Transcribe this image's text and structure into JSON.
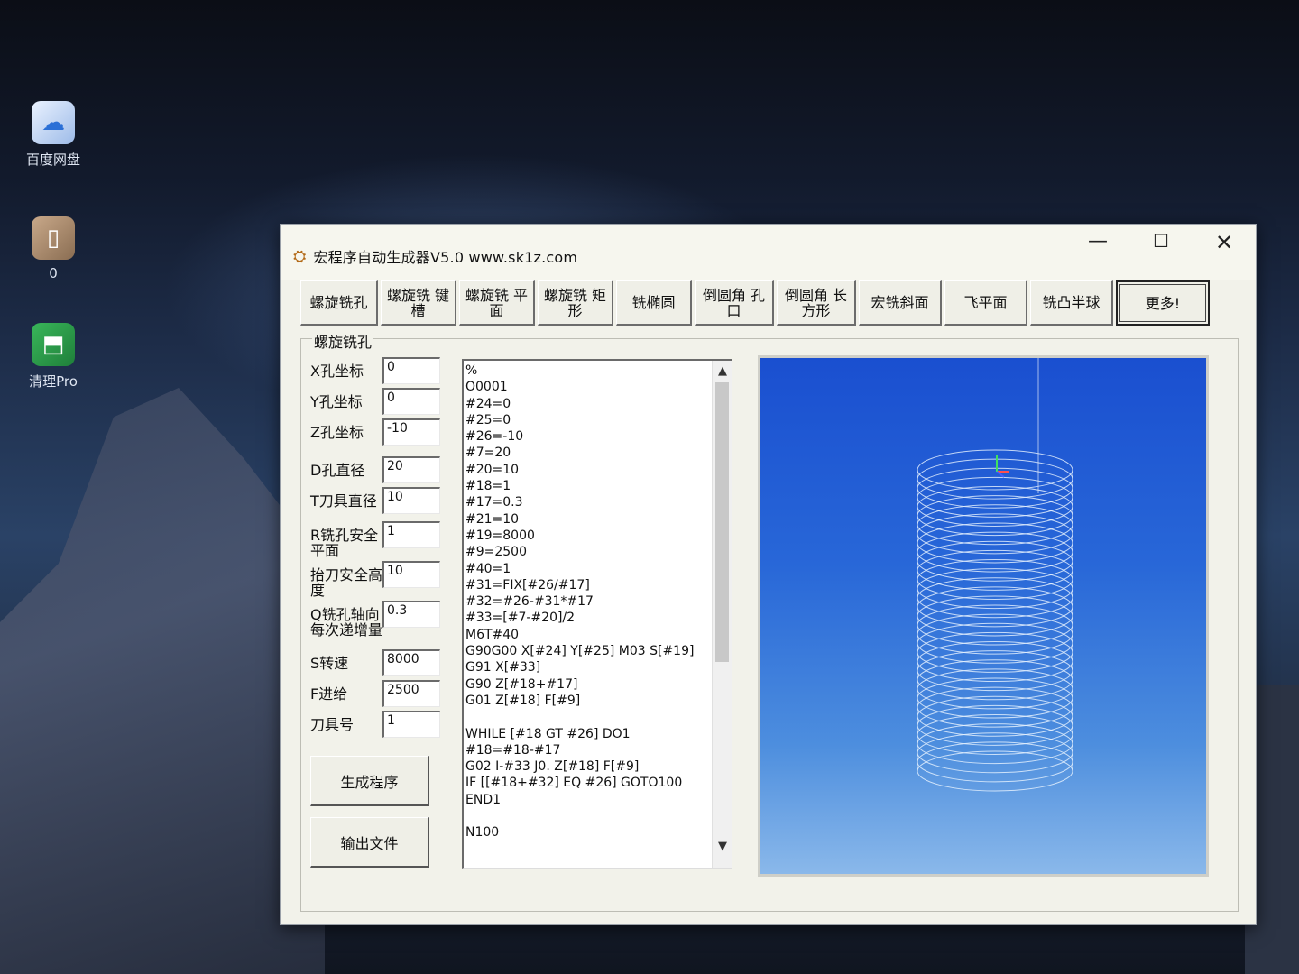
{
  "desktop": {
    "icons": [
      {
        "label": "百度网盘",
        "icon": "baidu-netdisk-icon"
      },
      {
        "label": "0",
        "icon": "file-icon"
      },
      {
        "label": "清理Pro",
        "icon": "cleaner-pro-icon"
      }
    ]
  },
  "window": {
    "title": "宏程序自动生成器V5.0    www.sk1z.com",
    "controls": {
      "minimize": "—",
      "maximize": "☐",
      "close": "✕"
    }
  },
  "tabs": [
    {
      "label": "螺旋铣孔",
      "width": 86
    },
    {
      "label": "螺旋铣 键槽",
      "width": 84
    },
    {
      "label": "螺旋铣 平面",
      "width": 84
    },
    {
      "label": "螺旋铣 矩形",
      "width": 84
    },
    {
      "label": "铣椭圆",
      "width": 84
    },
    {
      "label": "倒圆角 孔口",
      "width": 88
    },
    {
      "label": "倒圆角 长方形",
      "width": 88
    },
    {
      "label": "宏铣斜面",
      "width": 92
    },
    {
      "label": "飞平面",
      "width": 92
    },
    {
      "label": "铣凸半球",
      "width": 92
    },
    {
      "label": "更多!",
      "width": 104
    }
  ],
  "form": {
    "group_title": "螺旋铣孔",
    "fields": [
      {
        "label": "X孔坐标",
        "value": "0"
      },
      {
        "label": "Y孔坐标",
        "value": "0"
      },
      {
        "label": "Z孔坐标",
        "value": "-10"
      },
      {
        "label": "D孔直径",
        "value": "20"
      },
      {
        "label": "T刀具直径",
        "value": "10"
      },
      {
        "label": "R铣孔安全平面",
        "value": "1"
      },
      {
        "label": "抬刀安全高度",
        "value": "10"
      },
      {
        "label": "Q铣孔轴向每次递增量",
        "value": "0.3"
      },
      {
        "label": "S转速",
        "value": "8000"
      },
      {
        "label": "F进给",
        "value": "2500"
      },
      {
        "label": "刀具号",
        "value": "1"
      }
    ],
    "generate_button": "生成程序",
    "export_button": "输出文件"
  },
  "code_lines": [
    "%",
    "O0001",
    "#24=0",
    "#25=0",
    "#26=-10",
    "#7=20",
    "#20=10",
    "#18=1",
    "#17=0.3",
    "#21=10",
    "#19=8000",
    "#9=2500",
    "#40=1",
    "#31=FIX[#26/#17]",
    "#32=#26-#31*#17",
    "#33=[#7-#20]/2",
    "M6T#40",
    "G90G00 X[#24] Y[#25] M03 S[#19]",
    "G91 X[#33]",
    "G90 Z[#18+#17]",
    "G01 Z[#18] F[#9]",
    "",
    "WHILE [#18 GT #26] DO1",
    "#18=#18-#17",
    "G02 I-#33 J0. Z[#18] F[#9]",
    "IF [[#18+#32] EQ #26] GOTO100",
    "END1",
    "",
    "N100"
  ],
  "preview": {
    "helix_turns": 34
  }
}
